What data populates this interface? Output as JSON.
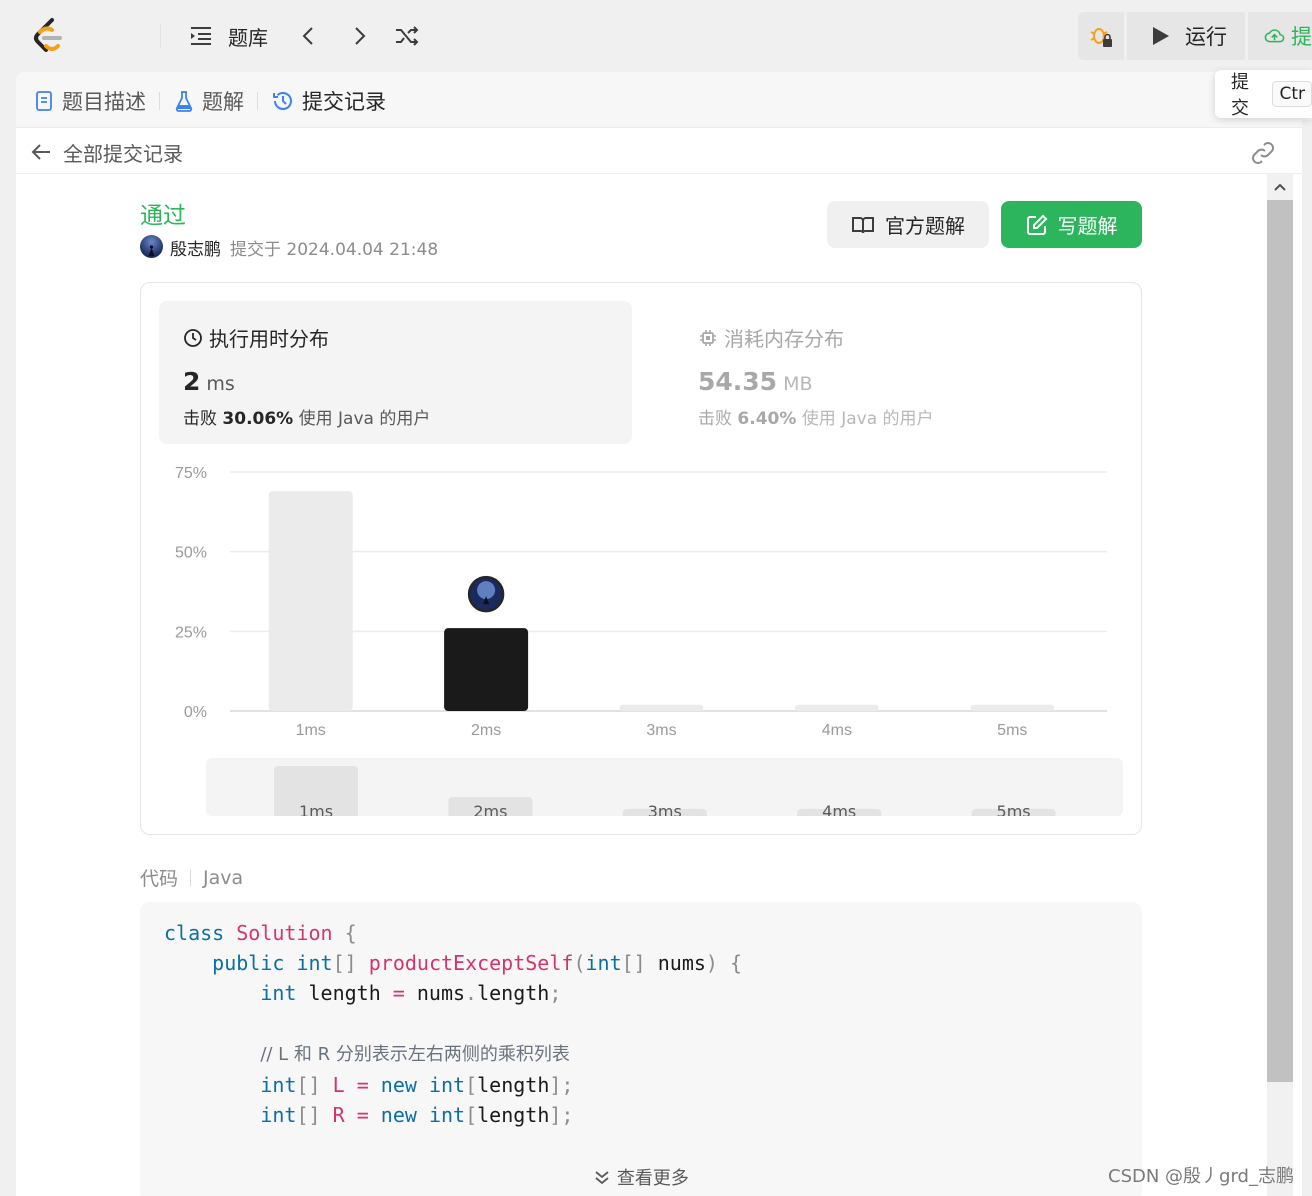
{
  "topbar": {
    "problem_bank": "题库",
    "run": "运行",
    "submit_cut": "提"
  },
  "tabs": [
    {
      "label": "题目描述"
    },
    {
      "label": "题解"
    },
    {
      "label": "提交记录"
    }
  ],
  "back": {
    "label": "全部提交记录"
  },
  "submission": {
    "status": "通过",
    "author": "殷志鹏",
    "submitted_at": "提交于 2024.04.04 21:48"
  },
  "buttons": {
    "official": "官方题解",
    "write": "写题解"
  },
  "runtime": {
    "title": "执行用时分布",
    "value": "2",
    "unit": "ms",
    "beat_prefix": "击败",
    "beat_pct": "30.06%",
    "beat_suffix": "使用 Java 的用户"
  },
  "memory": {
    "title": "消耗内存分布",
    "value": "54.35",
    "unit": "MB",
    "beat_prefix": "击败",
    "beat_pct": "6.40%",
    "beat_suffix": "使用 Java 的用户"
  },
  "chart_data": {
    "type": "bar",
    "categories": [
      "1ms",
      "2ms",
      "3ms",
      "4ms",
      "5ms"
    ],
    "values": [
      69,
      26,
      2,
      2,
      2
    ],
    "highlight_index": 1,
    "yticks": [
      "0%",
      "25%",
      "50%",
      "75%"
    ],
    "ylim": [
      0,
      75
    ],
    "grid": true,
    "mini_values": [
      21,
      8,
      3,
      3,
      3
    ]
  },
  "code": {
    "label": "代码",
    "lang": "Java",
    "see_more": "查看更多"
  },
  "popup": {
    "label": "提交",
    "shortcut": "Ctr"
  },
  "watermark": "CSDN @殷丿grd_志鹏",
  "colors": {
    "accent": "#2db55d",
    "bar_active": "#1a1a1a",
    "bar": "#ebebeb"
  }
}
